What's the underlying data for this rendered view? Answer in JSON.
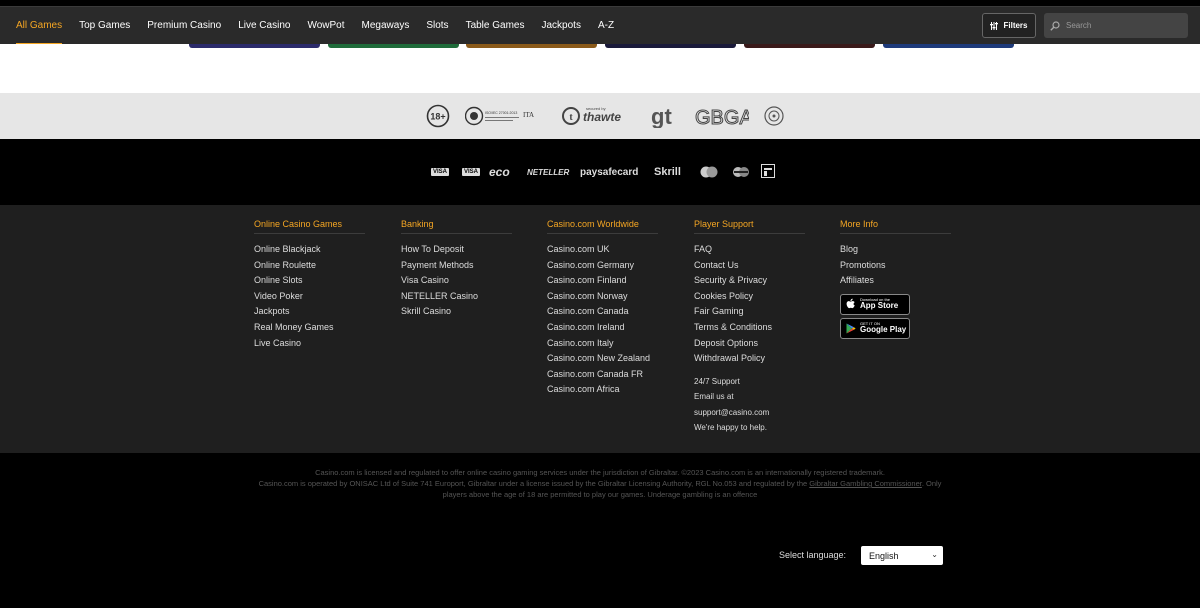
{
  "nav": {
    "items": [
      "All Games",
      "Top Games",
      "Premium Casino",
      "Live Casino",
      "WowPot",
      "Megaways",
      "Slots",
      "Table Games",
      "Jackpots",
      "A-Z"
    ],
    "active": "All Games",
    "filters_label": "Filters",
    "search_placeholder": "Search"
  },
  "colors": {
    "accent": "#f5a623",
    "topbar": "#2a2a2a",
    "footer": "#1f1f1f"
  },
  "certs": [
    "18+",
    "ISO/IEC 27001:2013",
    "ITA",
    "secured by thawte",
    "gt",
    "GBGA",
    "crest-seal"
  ],
  "payments": [
    "VISA",
    "VISA",
    "eco",
    "NETELLER",
    "paysafecard",
    "Skrill",
    "mastercard",
    "maestro",
    "bank-card"
  ],
  "footer": {
    "columns": [
      {
        "title": "Online Casino Games",
        "links": [
          "Online Blackjack",
          "Online Roulette",
          "Online Slots",
          "Video Poker",
          "Jackpots",
          "Real Money Games",
          "Live Casino"
        ]
      },
      {
        "title": "Banking",
        "links": [
          "How To Deposit",
          "Payment Methods",
          "Visa Casino",
          "NETELLER Casino",
          "Skrill Casino"
        ]
      },
      {
        "title": "Casino.com Worldwide",
        "links": [
          "Casino.com UK",
          "Casino.com Germany",
          "Casino.com Finland",
          "Casino.com Norway",
          "Casino.com Canada",
          "Casino.com Ireland",
          "Casino.com Italy",
          "Casino.com New Zealand",
          "Casino.com Canada FR",
          "Casino.com Africa"
        ]
      },
      {
        "title": "Player Support",
        "links": [
          "FAQ",
          "Contact Us",
          "Security & Privacy",
          "Cookies Policy",
          "Fair Gaming",
          "Terms & Conditions",
          "Deposit Options",
          "Withdrawal Policy"
        ],
        "support": [
          "24/7 Support",
          "Email us at",
          "support@casino.com",
          "We're happy to help."
        ]
      },
      {
        "title": "More Info",
        "links": [
          "Blog",
          "Promotions",
          "Affiliates"
        ],
        "app_store": {
          "small": "Download on the",
          "big": "App Store"
        },
        "google_play": {
          "small": "GET IT ON",
          "big": "Google Play"
        }
      }
    ]
  },
  "legal": {
    "line1": "Casino.com is licensed and regulated to offer online casino gaming services under the jurisdiction of Gibraltar. ©2023 Casino.com is an internationally registered trademark.",
    "line2a": "Casino.com is operated by ONISAC Ltd of Suite 741 Europort, Gibraltar under a license issued by the Gibraltar Licensing Authority, RGL No.053 and regulated by the ",
    "link": "Gibraltar Gambling Commissioner",
    "line2b": ". Only players above the age of 18 are permitted to play our games. Underage gambling is an offence"
  },
  "language": {
    "label": "Select language:",
    "selected": "English"
  }
}
